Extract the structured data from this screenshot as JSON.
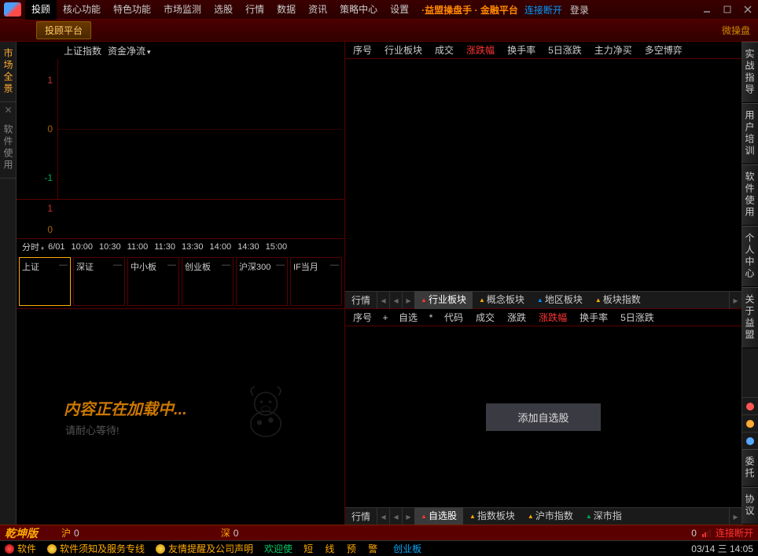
{
  "titlebar": {
    "menu": [
      "投顾",
      "核心功能",
      "特色功能",
      "市场监测",
      "选股",
      "行情",
      "数据",
      "资讯",
      "策略中心",
      "设置"
    ],
    "active_menu": 0,
    "brand": "·益盟操盘手 · 金融平台",
    "conn": "连接断开",
    "login": "登录"
  },
  "toolbar": {
    "btn": "投顾平台",
    "right": "微操盘"
  },
  "left_tabs": {
    "t1": "市场全景",
    "t2": "软件使用"
  },
  "chart": {
    "label_index": "上证指数",
    "label_flow": "资金净流",
    "y_main": [
      "1",
      "0",
      "-1"
    ],
    "y_mini": [
      "1",
      "0"
    ],
    "x": [
      "分时",
      "6/01",
      "10:00",
      "10:30",
      "11:00",
      "11:30",
      "13:30",
      "14:00",
      "14:30",
      "15:00"
    ]
  },
  "index_tabs": [
    {
      "name": "上证",
      "val": "—"
    },
    {
      "name": "深证",
      "val": "—"
    },
    {
      "name": "中小板",
      "val": "—"
    },
    {
      "name": "创业板",
      "val": "—"
    },
    {
      "name": "沪深300",
      "val": "—"
    },
    {
      "name": "IF当月",
      "val": "—"
    }
  ],
  "table_top": {
    "cols": [
      "序号",
      "行业板块",
      "成交",
      "涨跌幅",
      "换手率",
      "5日涨跌",
      "主力净买",
      "多空博弈"
    ],
    "hl": 3,
    "footer_label": "行情",
    "footer_tabs": [
      {
        "t": "行业板块",
        "c": "r",
        "active": true
      },
      {
        "t": "概念板块",
        "c": "y"
      },
      {
        "t": "地区板块",
        "c": "b"
      },
      {
        "t": "板块指数",
        "c": "y"
      }
    ]
  },
  "table_bottom": {
    "cols": [
      "序号",
      "自选",
      "代码",
      "成交",
      "涨跌",
      "涨跌幅",
      "换手率",
      "5日涨跌"
    ],
    "hl": 5,
    "star_after": 1,
    "btn": "添加自选股",
    "footer_label": "行情",
    "footer_tabs": [
      {
        "t": "自选股",
        "c": "r",
        "active": true
      },
      {
        "t": "指数板块",
        "c": "y"
      },
      {
        "t": "沪市指数",
        "c": "y"
      },
      {
        "t": "深市指",
        "c": "g"
      }
    ]
  },
  "loading": {
    "l1": "内容正在加载中...",
    "l2": "请耐心等待!"
  },
  "right_tabs": [
    "实战指导",
    "用户培训",
    "软件使用",
    "个人中心",
    "关于益盟"
  ],
  "right_bottom": [
    "委托",
    "协议"
  ],
  "status1": {
    "edition": "乾坤版",
    "mkt1": "沪",
    "v1": "0",
    "mkt2": "深",
    "v2": "0",
    "disc": "连接断开"
  },
  "status2": {
    "s1": "软件",
    "s2": "软件须知及服务专线",
    "s3": "友情提醒及公司声明",
    "s4": "欢迎使",
    "s5": "短 线 预 警",
    "s6": "创业板",
    "dt": "03/14 三  14:05"
  },
  "chart_data": {
    "type": "line",
    "title": "上证指数 资金净流 分时",
    "x": [
      "6/01",
      "10:00",
      "10:30",
      "11:00",
      "11:30",
      "13:30",
      "14:00",
      "14:30",
      "15:00"
    ],
    "series": [],
    "y_main_range": [
      -1,
      1
    ],
    "y_mini_range": [
      0,
      1
    ]
  }
}
